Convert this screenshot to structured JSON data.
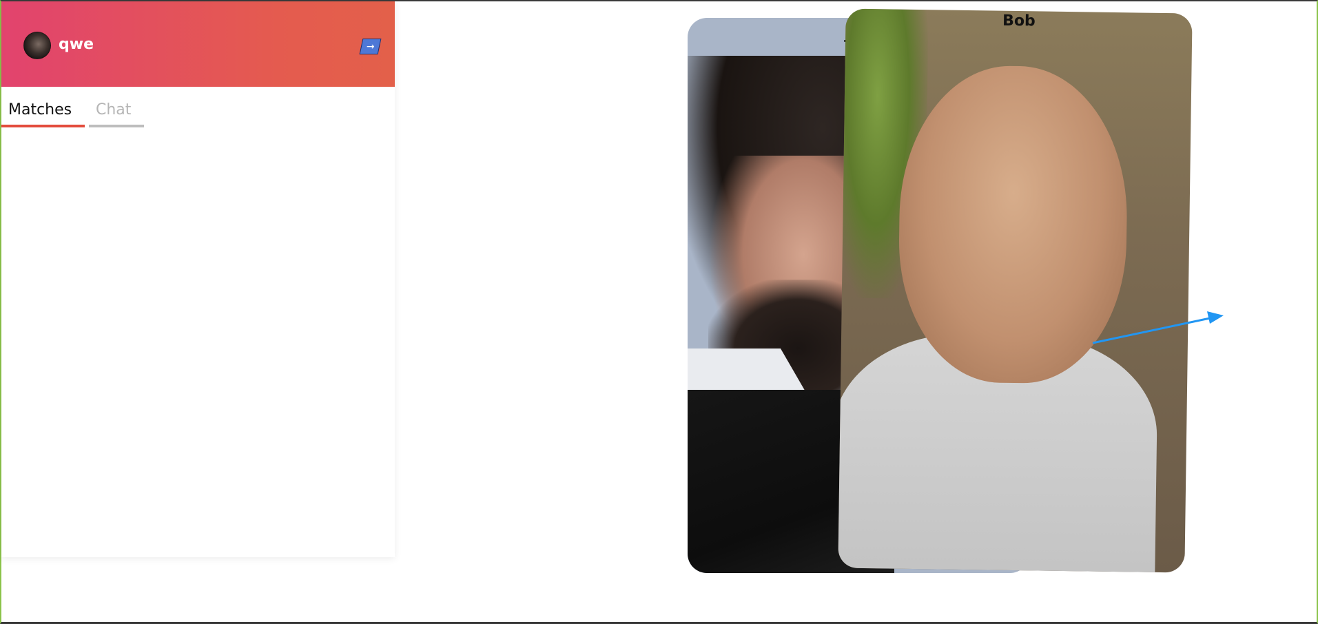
{
  "sidebar": {
    "user": {
      "name": "qwe",
      "avatar_icon": "user-avatar"
    },
    "logout_icon": "logout-arrow-icon",
    "logout_glyph": "→",
    "header_gradient": [
      "#e2436e",
      "#e3604a"
    ],
    "tabs": [
      {
        "label": "Matches",
        "active": true,
        "accent": "#e34b3c"
      },
      {
        "label": "Chat",
        "active": false,
        "accent": "#bdbdbd"
      }
    ]
  },
  "cards": {
    "back": {
      "name_fragment": "7"
    },
    "front": {
      "name": "Bob"
    }
  },
  "swipe_indicator": {
    "icon": "swipe-right-arrow-icon",
    "color": "#2196f3"
  }
}
